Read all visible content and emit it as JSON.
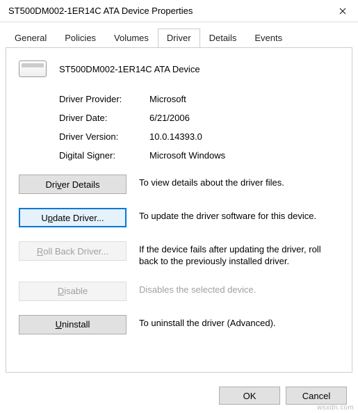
{
  "window": {
    "title": "ST500DM002-1ER14C ATA Device Properties"
  },
  "tabs": {
    "items": [
      "General",
      "Policies",
      "Volumes",
      "Driver",
      "Details",
      "Events"
    ],
    "selected": "Driver"
  },
  "device": {
    "name": "ST500DM002-1ER14C ATA Device"
  },
  "info": {
    "provider_label": "Driver Provider:",
    "provider_value": "Microsoft",
    "date_label": "Driver Date:",
    "date_value": "6/21/2006",
    "version_label": "Driver Version:",
    "version_value": "10.0.14393.0",
    "signer_label": "Digital Signer:",
    "signer_value": "Microsoft Windows"
  },
  "actions": {
    "details_label": "Driver Details",
    "details_desc": "To view details about the driver files.",
    "update_label": "Update Driver...",
    "update_desc": "To update the driver software for this device.",
    "rollback_label": "Roll Back Driver...",
    "rollback_desc": "If the device fails after updating the driver, roll back to the previously installed driver.",
    "disable_label": "Disable",
    "disable_desc": "Disables the selected device.",
    "uninstall_label": "Uninstall",
    "uninstall_desc": "To uninstall the driver (Advanced)."
  },
  "footer": {
    "ok": "OK",
    "cancel": "Cancel"
  },
  "watermark": "wsxdn.com"
}
